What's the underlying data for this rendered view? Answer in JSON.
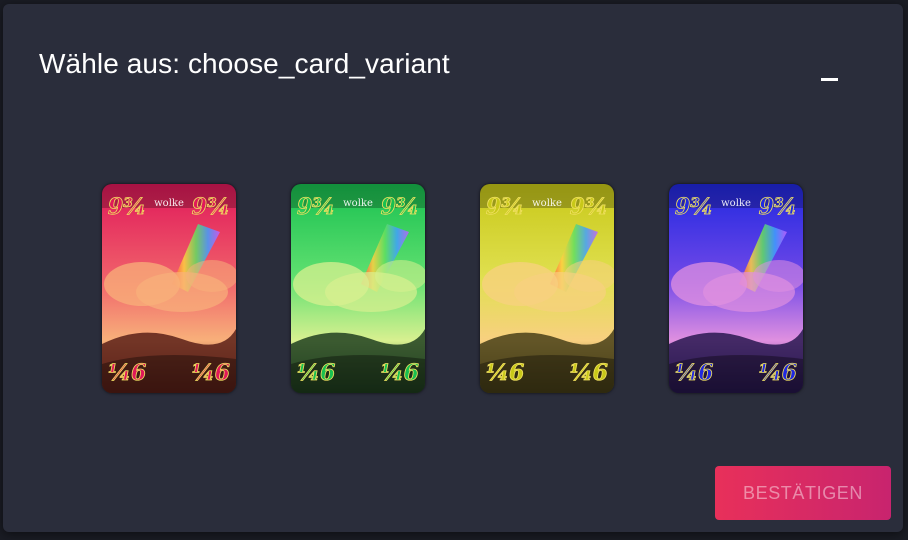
{
  "dialog": {
    "title": "Wähle aus: choose_card_variant",
    "minimize_icon": "minimize-icon",
    "confirm_label": "BESTÄTIGEN"
  },
  "cards": [
    {
      "name": "wolke",
      "top_left_value": "9¾",
      "top_right_value": "9¾",
      "bottom_left_value": "¼6",
      "bottom_right_value": "¼6",
      "sky_top": "#e0185a",
      "sky_mid": "#f0606a",
      "cloud": "#f8b07a",
      "ground": "#5a2018"
    },
    {
      "name": "wolke",
      "top_left_value": "9¾",
      "top_right_value": "9¾",
      "bottom_left_value": "¼6",
      "bottom_right_value": "¼6",
      "sky_top": "#18c050",
      "sky_mid": "#60e070",
      "cloud": "#d8f090",
      "ground": "#204020"
    },
    {
      "name": "wolke",
      "top_left_value": "9¾",
      "top_right_value": "9¾",
      "bottom_left_value": "¼6",
      "bottom_right_value": "¼6",
      "sky_top": "#c8c818",
      "sky_mid": "#e0e050",
      "cloud": "#f8d080",
      "ground": "#484018"
    },
    {
      "name": "wolke",
      "top_left_value": "9¾",
      "top_right_value": "9¾",
      "bottom_left_value": "¼6",
      "bottom_right_value": "¼6",
      "sky_top": "#2028e0",
      "sky_mid": "#7048e8",
      "cloud": "#e090e0",
      "ground": "#281850"
    }
  ]
}
